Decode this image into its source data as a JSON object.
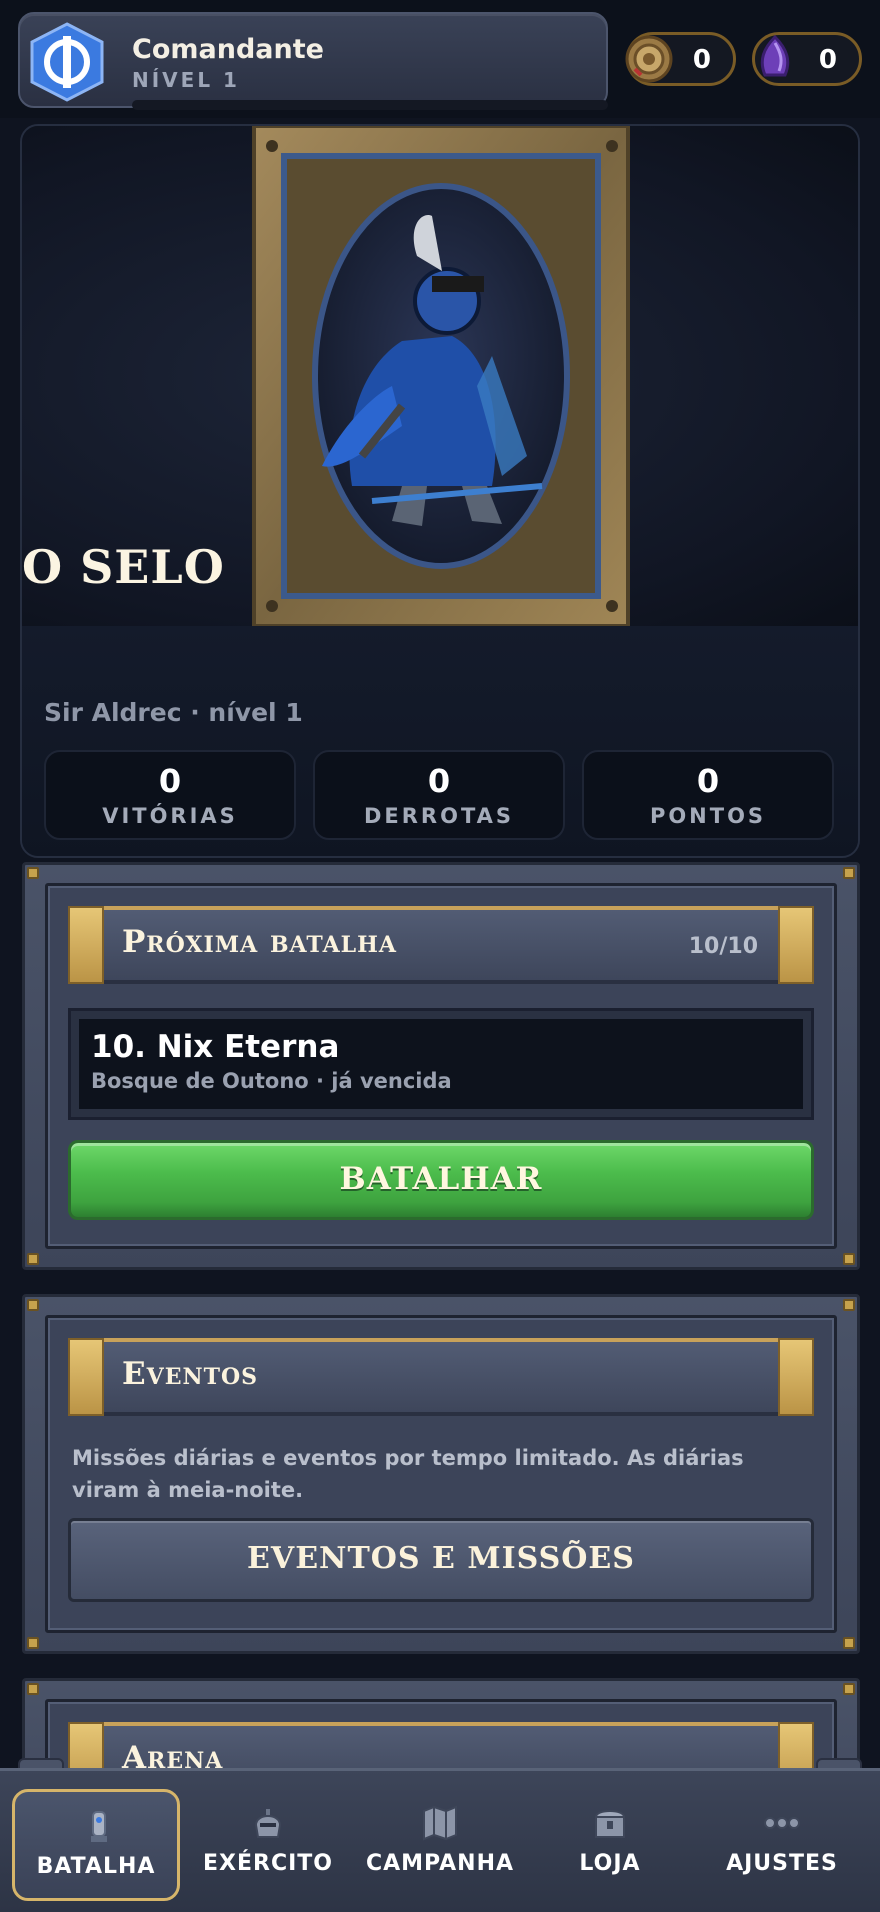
{
  "profile": {
    "name": "Comandante",
    "level_label": "NÍVEL 1",
    "xp_progress": 0
  },
  "currencies": [
    {
      "icon": "gold-coin-icon",
      "value": "0"
    },
    {
      "icon": "purple-crystal-icon",
      "value": "0"
    }
  ],
  "hero": {
    "title": "O SELO",
    "subtitle": "Sir Aldrec · nível 1",
    "stats": [
      {
        "value": "0",
        "label": "VITÓRIAS"
      },
      {
        "value": "0",
        "label": "DERROTAS"
      },
      {
        "value": "0",
        "label": "PONTOS"
      }
    ]
  },
  "next_battle": {
    "title": "Próxima batalha",
    "progress": "10/10",
    "stage_name": "10. Nix Eterna",
    "stage_sub": "Bosque de Outono · já vencida",
    "button_label": "BATALHAR"
  },
  "events": {
    "title": "Eventos",
    "description": "Missões diárias e eventos por tempo limitado. As diárias viram à meia-noite.",
    "button_label": "EVENTOS E MISSÕES"
  },
  "arena": {
    "title": "Arena"
  },
  "nav": {
    "items": [
      {
        "label": "BATALHA",
        "icon": "battle-icon",
        "active": true
      },
      {
        "label": "EXÉRCITO",
        "icon": "helmet-icon",
        "active": false
      },
      {
        "label": "CAMPANHA",
        "icon": "map-icon",
        "active": false
      },
      {
        "label": "LOJA",
        "icon": "chest-icon",
        "active": false
      },
      {
        "label": "AJUSTES",
        "icon": "dots-icon",
        "active": false
      }
    ]
  },
  "colors": {
    "accent_gold": "#d6b56a",
    "battle_green": "#4cbc4c",
    "panel_slate": "#4a5368",
    "background": "#0f1420"
  }
}
